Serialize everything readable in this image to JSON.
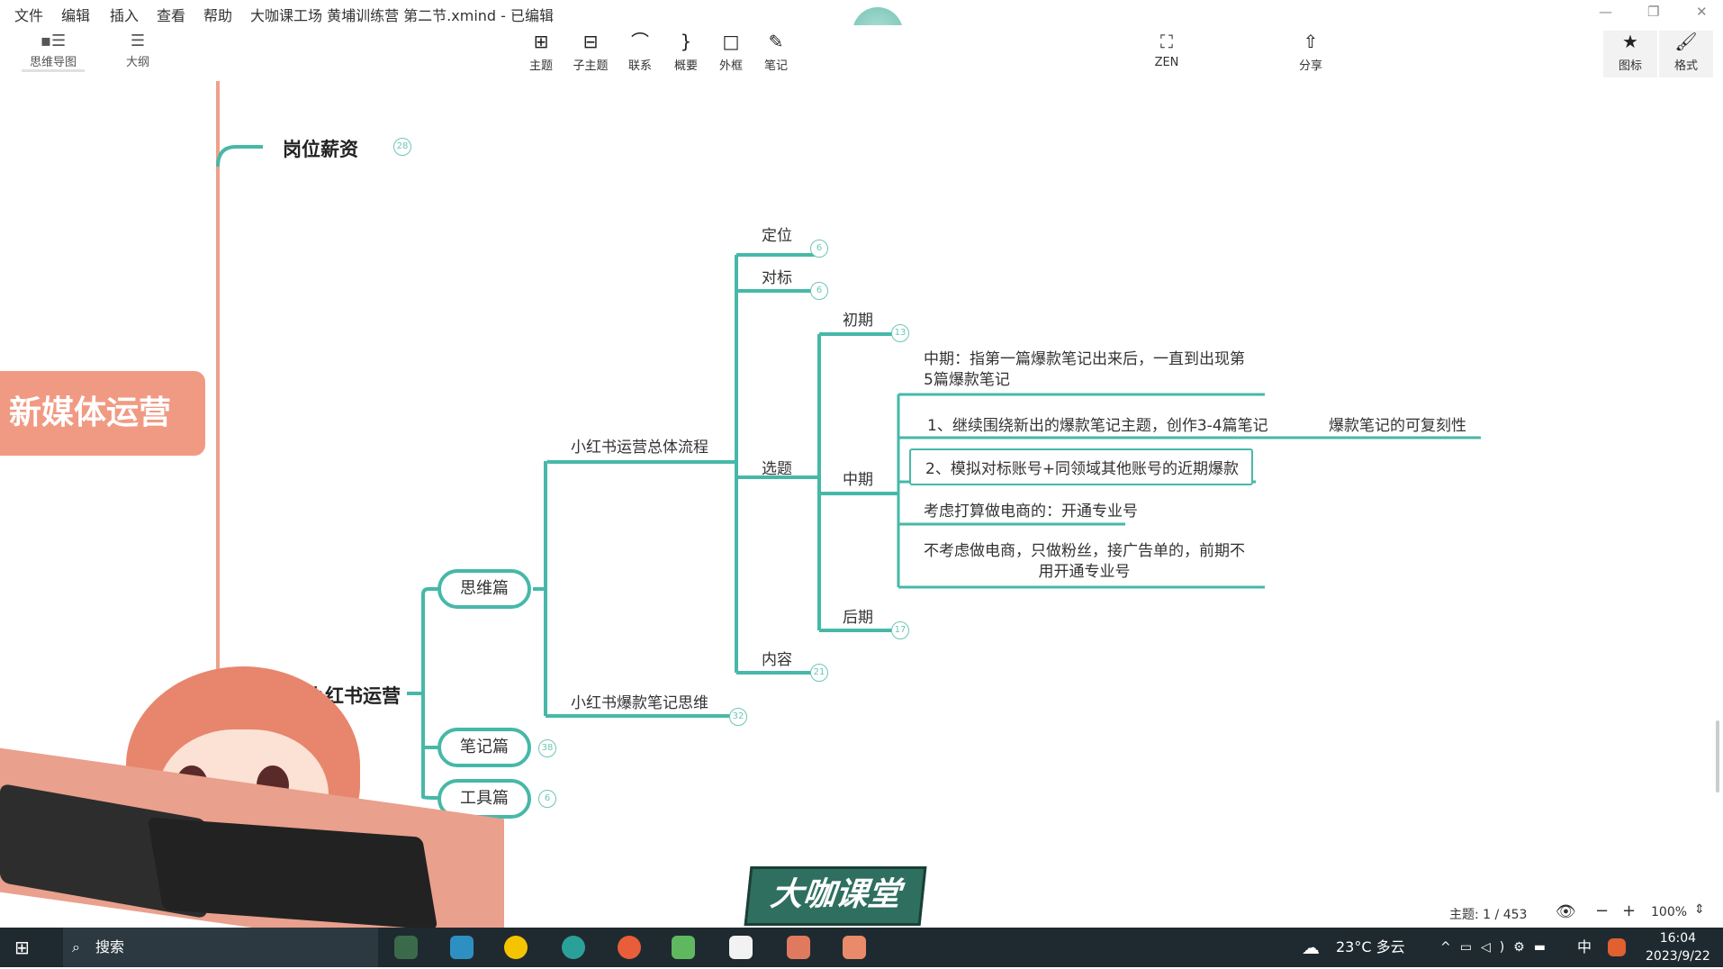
{
  "window": {
    "title": "大咖课工场 黄埔训练营 第二节.xmind - 已编辑",
    "menu": [
      "文件",
      "编辑",
      "插入",
      "查看",
      "帮助"
    ]
  },
  "toolbar": {
    "view_tabs": [
      {
        "label": "思维导图",
        "icon": "mindmap-icon"
      },
      {
        "label": "大纲",
        "icon": "outline-icon"
      }
    ],
    "tools": [
      {
        "label": "主题",
        "icon": "topic-plus-icon"
      },
      {
        "label": "子主题",
        "icon": "subtopic-plus-icon"
      },
      {
        "label": "联系",
        "icon": "relationship-arc-icon"
      },
      {
        "label": "概要",
        "icon": "summary-brace-icon"
      },
      {
        "label": "外框",
        "icon": "boundary-square-icon"
      },
      {
        "label": "笔记",
        "icon": "note-pencil-icon"
      }
    ],
    "zen": {
      "label": "ZEN",
      "icon": "fullscreen-icon"
    },
    "share": {
      "label": "分享",
      "icon": "share-upload-icon"
    },
    "icon_panel": {
      "label": "图标",
      "icon": "star-icon"
    },
    "format_panel": {
      "label": "格式",
      "icon": "brush-icon"
    }
  },
  "mindmap": {
    "root": "新媒体运营",
    "branch_salary": {
      "label": "岗位薪资",
      "count": "28"
    },
    "branch_xhs": {
      "label": "小红书运营"
    },
    "thinking": {
      "label": "思维篇"
    },
    "notes": {
      "label": "笔记篇",
      "count": "38"
    },
    "tools": {
      "label": "工具篇",
      "count": "6"
    },
    "flow": {
      "label": "小红书运营总体流程"
    },
    "viral": {
      "label": "小红书爆款笔记思维",
      "count": "32"
    },
    "positioning": {
      "label": "定位",
      "count": "6"
    },
    "benchmark": {
      "label": "对标",
      "count": "6"
    },
    "topic_select": {
      "label": "选题"
    },
    "content": {
      "label": "内容",
      "count": "21"
    },
    "early": {
      "label": "初期",
      "count": "13"
    },
    "middle": {
      "label": "中期"
    },
    "late": {
      "label": "后期",
      "count": "17"
    },
    "middle_def_line1": "中期：指第一篇爆款笔记出来后，一直到出现第",
    "middle_def_line2": "5篇爆款笔记",
    "item1": "1、继续围绕新出的爆款笔记主题，创作3-4篇笔记",
    "item1_note": "爆款笔记的可复刻性",
    "item2": "2、模拟对标账号+同领域其他账号的近期爆款",
    "item3": "考虑打算做电商的：开通专业号",
    "item4_line1": "不考虑做电商，只做粉丝，接广告单的，前期不",
    "item4_line2": "用开通专业号"
  },
  "statusbar": {
    "topic_count": "主题: 1 / 453",
    "zoom": "100%"
  },
  "watermark": "大咖课堂",
  "taskbar": {
    "search": "搜索",
    "weather": "23°C 多云",
    "ime": "中",
    "time": "16:04",
    "date": "2023/9/22"
  },
  "colors": {
    "branch_line": "#47b8a8",
    "root_fill": "#f19a83",
    "root_line": "#f0a08a"
  }
}
